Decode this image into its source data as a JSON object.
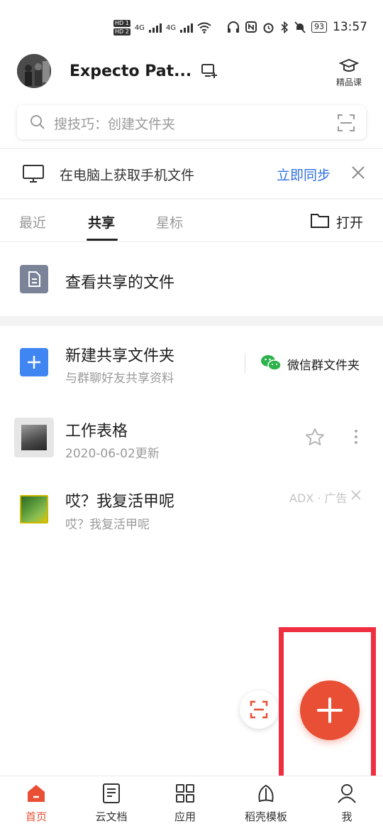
{
  "status_bar": {
    "hd1": "HD 1",
    "hd2": "HD 2",
    "net1": "4G",
    "net2": "4G",
    "battery": "93",
    "time": "13:57"
  },
  "header": {
    "username": "Expecto Pat...",
    "course_label": "精品课"
  },
  "search": {
    "placeholder": "搜技巧：创建文件夹"
  },
  "sync_banner": {
    "text": "在电脑上获取手机文件",
    "link": "立即同步"
  },
  "tabs": [
    {
      "label": "最近"
    },
    {
      "label": "共享"
    },
    {
      "label": "星标"
    }
  ],
  "active_tab": "共享",
  "open_button": "打开",
  "shared_files": {
    "label": "查看共享的文件"
  },
  "new_shared_folder": {
    "title": "新建共享文件夹",
    "subtitle": "与群聊好友共享资料",
    "wechat_label": "微信群文件夹"
  },
  "files": [
    {
      "name": "工作表格",
      "meta": "2020-06-02更新"
    }
  ],
  "ad": {
    "title": "哎？我复活甲呢",
    "subtitle": "哎？我复活甲呢",
    "label": "ADX · 广告"
  },
  "bottom_nav": [
    {
      "label": "首页"
    },
    {
      "label": "云文档"
    },
    {
      "label": "应用"
    },
    {
      "label": "稻壳模板"
    },
    {
      "label": "我"
    }
  ],
  "colors": {
    "accent": "#e94f35",
    "link": "#2f6fe0",
    "highlight": "#ef2f3f",
    "blue_square": "#3f86f2",
    "wechat": "#2bb34a"
  }
}
